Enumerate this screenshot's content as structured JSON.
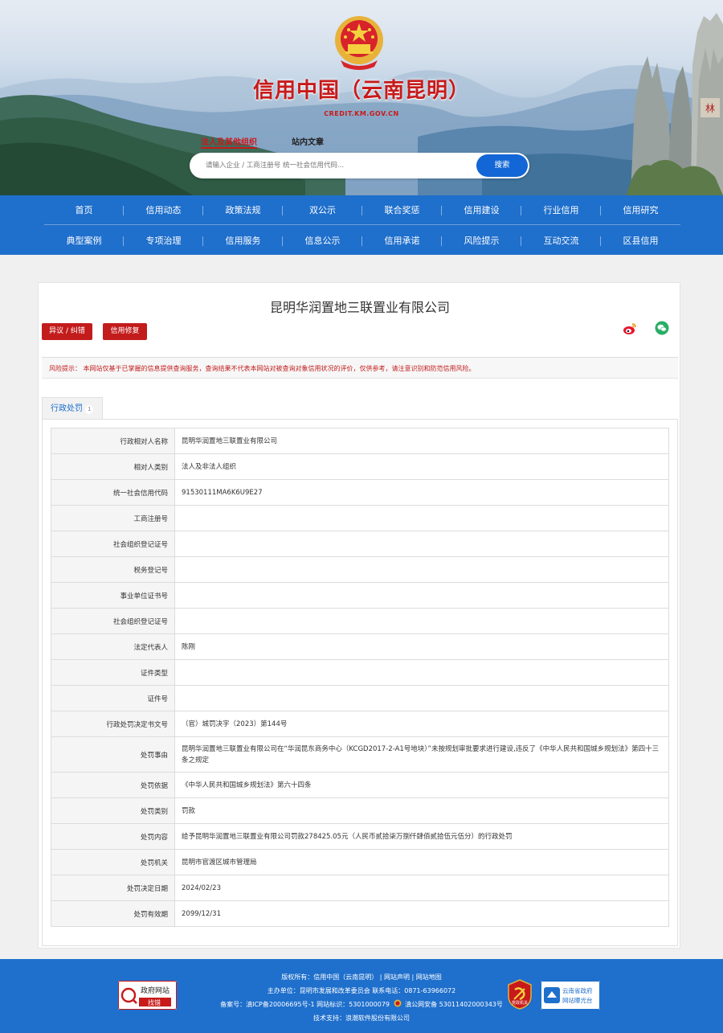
{
  "header": {
    "site_title": "信用中国（云南昆明）",
    "site_domain": "CREDIT.KM.GOV.CN",
    "search_tabs": [
      "法人及其他组织",
      "站内文章"
    ],
    "search_placeholder": "请输入企业 / 工商注册号 统一社会信用代码...",
    "search_button": "搜索"
  },
  "nav": {
    "row1": [
      "首页",
      "信用动态",
      "政策法规",
      "双公示",
      "联合奖惩",
      "信用建设",
      "行业信用",
      "信用研究"
    ],
    "row2": [
      "典型案例",
      "专项治理",
      "信用服务",
      "信息公示",
      "信用承诺",
      "风险提示",
      "互动交流",
      "区县信用"
    ]
  },
  "company": {
    "name": "昆明华润置地三联置业有限公司",
    "objection_button": "异议 / 纠错",
    "repair_button": "信用修复",
    "risk_notice": "风险提示：  本网站仅基于已掌握的信息提供查询服务，查询结果不代表本网站对被查询对象信用状况的评价，仅供参考，请注意识别和防范信用风险。"
  },
  "tab": {
    "label": "行政处罚",
    "count": "1"
  },
  "details": [
    {
      "label": "行政相对人名称",
      "value": "昆明华润置地三联置业有限公司"
    },
    {
      "label": "相对人类别",
      "value": "法人及非法人组织"
    },
    {
      "label": "统一社会信用代码",
      "value": "91530111MA6K6U9E27"
    },
    {
      "label": "工商注册号",
      "value": ""
    },
    {
      "label": "社会组织登记证号",
      "value": ""
    },
    {
      "label": "税务登记号",
      "value": ""
    },
    {
      "label": "事业单位证书号",
      "value": ""
    },
    {
      "label": "社会组织登记证号",
      "value": ""
    },
    {
      "label": "法定代表人",
      "value": "陈刚"
    },
    {
      "label": "证件类型",
      "value": ""
    },
    {
      "label": "证件号",
      "value": ""
    },
    {
      "label": "行政处罚决定书文号",
      "value": "（官）城罚决字（2023）第144号"
    },
    {
      "label": "处罚事由",
      "value": "昆明华润置地三联置业有限公司在“华润昆东商务中心（KCGD2017-2-A1号地块）”未按规划审批要求进行建设,违反了《中华人民共和国城乡规划法》第四十三条之规定"
    },
    {
      "label": "处罚依据",
      "value": "《中华人民共和国城乡规划法》第六十四条"
    },
    {
      "label": "处罚类别",
      "value": "罚款"
    },
    {
      "label": "处罚内容",
      "value": "给予昆明华润置地三联置业有限公司罚款278425.05元（人民币贰拾柒万捌仟肆佰贰拾伍元伍分）的行政处罚"
    },
    {
      "label": "处罚机关",
      "value": "昆明市官渡区城市管理局"
    },
    {
      "label": "处罚决定日期",
      "value": "2024/02/23"
    },
    {
      "label": "处罚有效期",
      "value": "2099/12/31"
    }
  ],
  "footer": {
    "copyright": "版权所有：信用中国（云南昆明） | 网站声明 | 网站地图",
    "sponsor": "主办单位：昆明市发展和改革委员会   联系电话：0871-63966072",
    "record": "备案号：滇ICP备20006695号-1   网站标识：5301000079",
    "police_record": "滇公网安备 53011402000343号",
    "tech": "技术支持：浪潮软件股份有限公司",
    "badge_left_top": "政府网站",
    "badge_left_bottom": "找错",
    "badge_emblem": "党政机关",
    "badge_right_top": "云南省政府",
    "badge_right_bottom": "网站曝光台"
  },
  "colors": {
    "brand_blue": "#1f6fcc",
    "brand_red": "#c31c1c",
    "search_blue": "#1366d6"
  },
  "icons": [
    "national-emblem-icon",
    "weibo-icon",
    "wechat-icon",
    "police-badge-icon",
    "gov-error-icon",
    "party-emblem-icon",
    "exposure-icon"
  ]
}
